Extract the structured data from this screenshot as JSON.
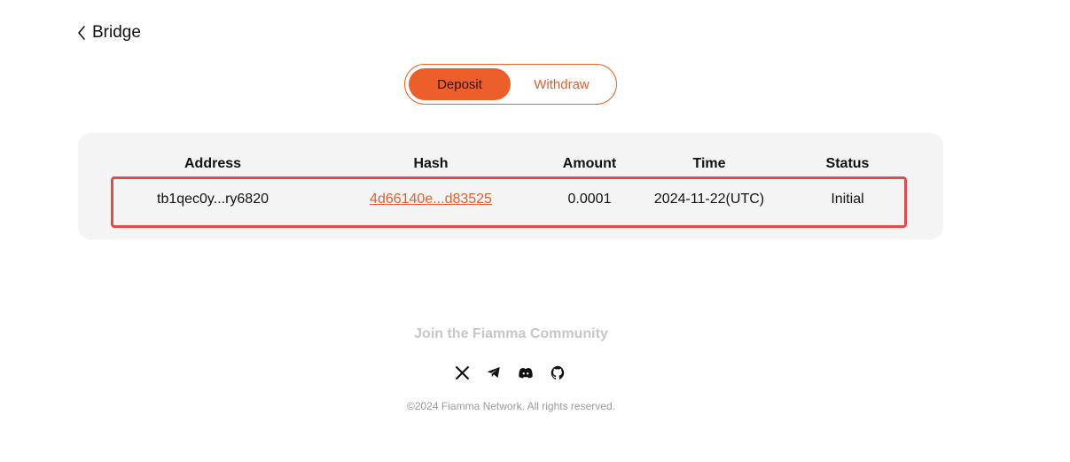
{
  "header": {
    "title": "Bridge"
  },
  "tabs": {
    "deposit": "Deposit",
    "withdraw": "Withdraw",
    "active": "Deposit"
  },
  "table": {
    "columns": [
      "Address",
      "Hash",
      "Amount",
      "Time",
      "Status"
    ],
    "rows": [
      {
        "address": "tb1qec0y...ry6820",
        "hash": "4d66140e...d83525",
        "amount": "0.0001",
        "time": "2024-11-22(UTC)",
        "status": "Initial"
      }
    ]
  },
  "footer": {
    "community": "Join the Fiamma Community",
    "socials": [
      "x-icon",
      "telegram-icon",
      "discord-icon",
      "github-icon"
    ],
    "copyright": "©2024 Fiamma Network. All rights reserved."
  },
  "colors": {
    "accent": "#ec5f2b",
    "highlight": "#e34a4a",
    "card": "#f4f4f4"
  }
}
